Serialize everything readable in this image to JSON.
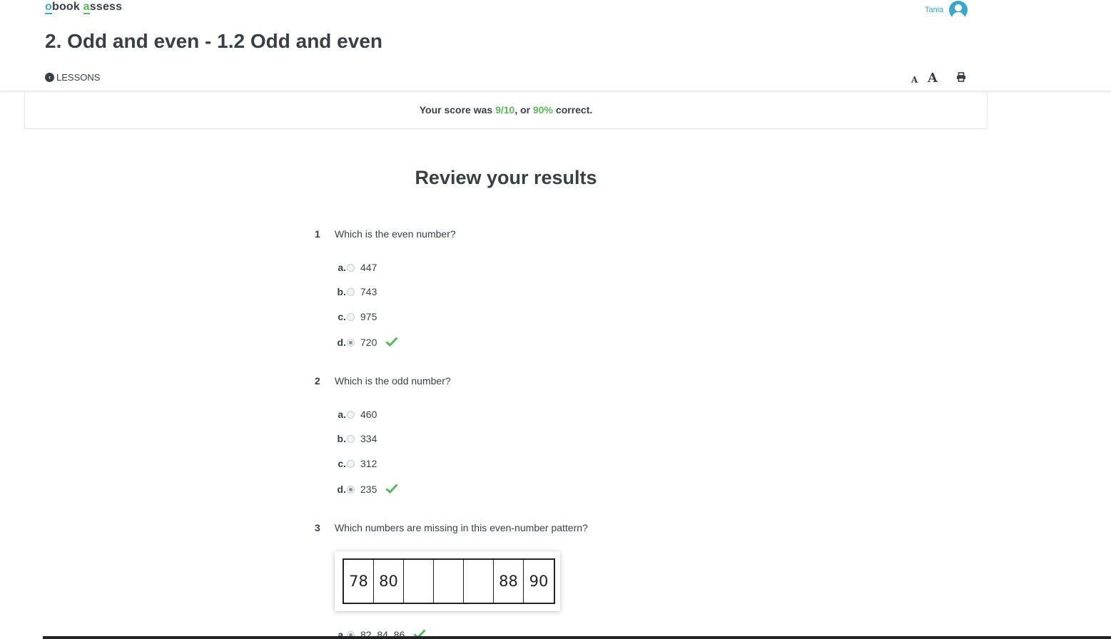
{
  "header": {
    "logo_o1": "o",
    "logo_book": "book ",
    "logo_o2": "a",
    "logo_ssess": "ssess",
    "user_name": "Tania",
    "page_title": "2. Odd and even - 1.2 Odd and even",
    "lessons_label": "LESSONS",
    "font_small_label": "A",
    "font_large_label": "A"
  },
  "score": {
    "prefix": "Your score was ",
    "score_value": "9/10",
    "middle": ", or ",
    "percent_value": "90%",
    "suffix": " correct."
  },
  "review_title": "Review your results",
  "questions": [
    {
      "number": "1",
      "text": "Which is the even number?",
      "options": [
        {
          "letter": "a.",
          "value": "447",
          "selected": false,
          "correct": false
        },
        {
          "letter": "b.",
          "value": "743",
          "selected": false,
          "correct": false
        },
        {
          "letter": "c.",
          "value": "975",
          "selected": false,
          "correct": false
        },
        {
          "letter": "d.",
          "value": "720",
          "selected": true,
          "correct": true
        }
      ]
    },
    {
      "number": "2",
      "text": "Which is the odd number?",
      "options": [
        {
          "letter": "a.",
          "value": "460",
          "selected": false,
          "correct": false
        },
        {
          "letter": "b.",
          "value": "334",
          "selected": false,
          "correct": false
        },
        {
          "letter": "c.",
          "value": "312",
          "selected": false,
          "correct": false
        },
        {
          "letter": "d.",
          "value": "235",
          "selected": true,
          "correct": true
        }
      ]
    },
    {
      "number": "3",
      "text": "Which numbers are missing in this even-number pattern?",
      "pattern": [
        "78",
        "80",
        "",
        "",
        "",
        "88",
        "90"
      ],
      "options": [
        {
          "letter": "a.",
          "value": "82, 84, 86",
          "selected": true,
          "correct": true
        }
      ]
    }
  ],
  "colors": {
    "accent_blue": "#3aa7c9",
    "correct_green": "#5cb85c",
    "text_dark": "#3a3f44"
  }
}
